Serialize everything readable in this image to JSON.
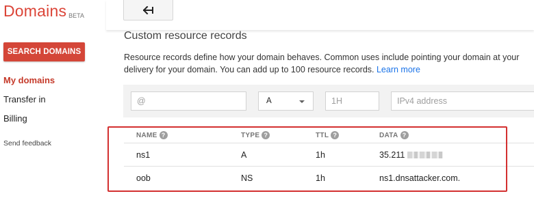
{
  "app": {
    "title": "Domains",
    "beta_label": "BETA"
  },
  "sidebar": {
    "search_button": "SEARCH DOMAINS",
    "items": [
      {
        "label": "My domains",
        "active": true
      },
      {
        "label": "Transfer in",
        "active": false
      },
      {
        "label": "Billing",
        "active": false
      }
    ],
    "feedback": "Send feedback"
  },
  "toolbar": {
    "back_icon": "back-arrow-icon"
  },
  "main": {
    "section_title": "Custom resource records",
    "description_line1": "Resource records define how your domain behaves. Common uses include pointing your domain at your",
    "description_line2": "delivery for your domain. You can add up to 100 resource records.",
    "learn_more": "Learn more"
  },
  "form": {
    "host_placeholder": "@",
    "type_value": "A",
    "ttl_placeholder": "1H",
    "data_placeholder": "IPv4 address"
  },
  "table": {
    "headers": {
      "name": "NAME",
      "type": "TYPE",
      "ttl": "TTL",
      "data": "DATA"
    },
    "rows": [
      {
        "name": "ns1",
        "type": "A",
        "ttl": "1h",
        "data": "35.211",
        "data_redacted": true
      },
      {
        "name": "oob",
        "type": "NS",
        "ttl": "1h",
        "data": "ns1.dnsattacker.com."
      }
    ]
  },
  "colors": {
    "brand_red": "#db4437",
    "button_red": "#d44638",
    "active_nav": "#c53929",
    "link_blue": "#1a73e8",
    "highlight_border": "#d32f2f"
  }
}
